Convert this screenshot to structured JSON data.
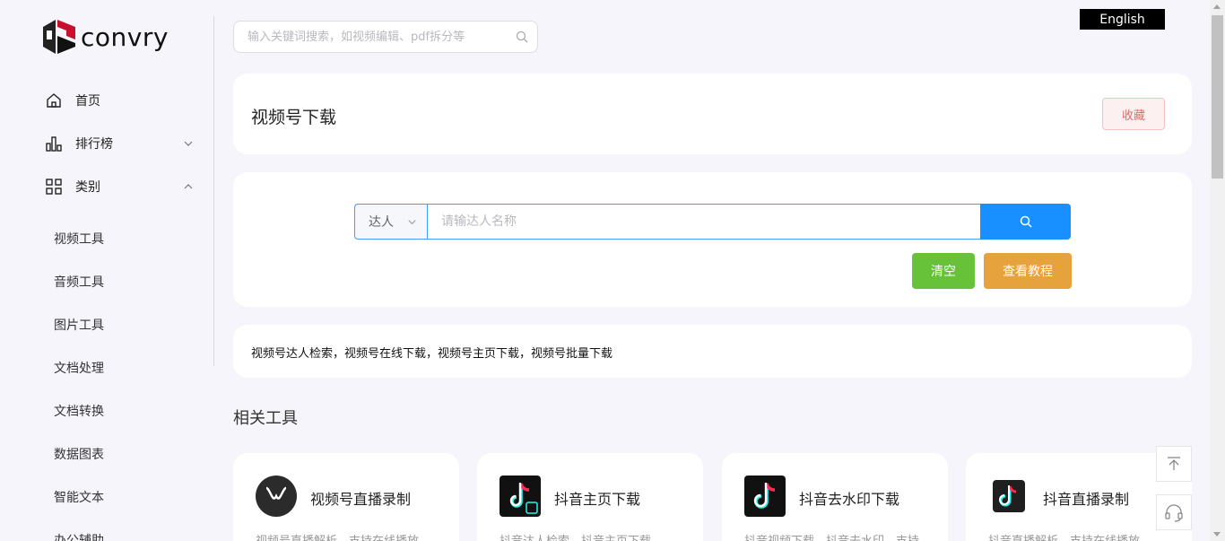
{
  "logo": {
    "text": "convry"
  },
  "sidebar": {
    "nav": [
      {
        "label": "首页",
        "icon": "home-icon"
      },
      {
        "label": "排行榜",
        "icon": "bar-chart-icon"
      },
      {
        "label": "类别",
        "icon": "grid-icon"
      }
    ],
    "categories": [
      "视频工具",
      "音频工具",
      "图片工具",
      "文档处理",
      "文档转换",
      "数据图表",
      "智能文本",
      "办公辅助"
    ]
  },
  "search": {
    "placeholder": "输入关键词搜索，如视频编辑、pdf拆分等"
  },
  "lang": {
    "label": "English"
  },
  "page": {
    "title": "视频号下载",
    "favorite_label": "收藏"
  },
  "tool": {
    "type_value": "达人",
    "input_placeholder": "请输达人名称",
    "clear_label": "清空",
    "tutorial_label": "查看教程"
  },
  "description": "视频号达人检索，视频号在线下载，视频号主页下载，视频号批量下载",
  "related": {
    "title": "相关工具",
    "items": [
      {
        "name": "视频号直播录制",
        "desc": "视频号直播解析，支持在线播放",
        "icon": "wechat-channels-icon"
      },
      {
        "name": "抖音主页下载",
        "desc": "抖音达人检索，抖音主页下载",
        "icon": "douyin-home-icon"
      },
      {
        "name": "抖音去水印下载",
        "desc": "抖音视频下载，抖音去水印，支持",
        "icon": "douyin-icon"
      },
      {
        "name": "抖音直播录制",
        "desc": "抖音直播解析，支持在线播放",
        "icon": "douyin-live-icon"
      }
    ]
  },
  "colors": {
    "primary": "#1890ff",
    "success": "#67c23a",
    "warning": "#e6a23c",
    "danger_text": "#e06a6a"
  }
}
